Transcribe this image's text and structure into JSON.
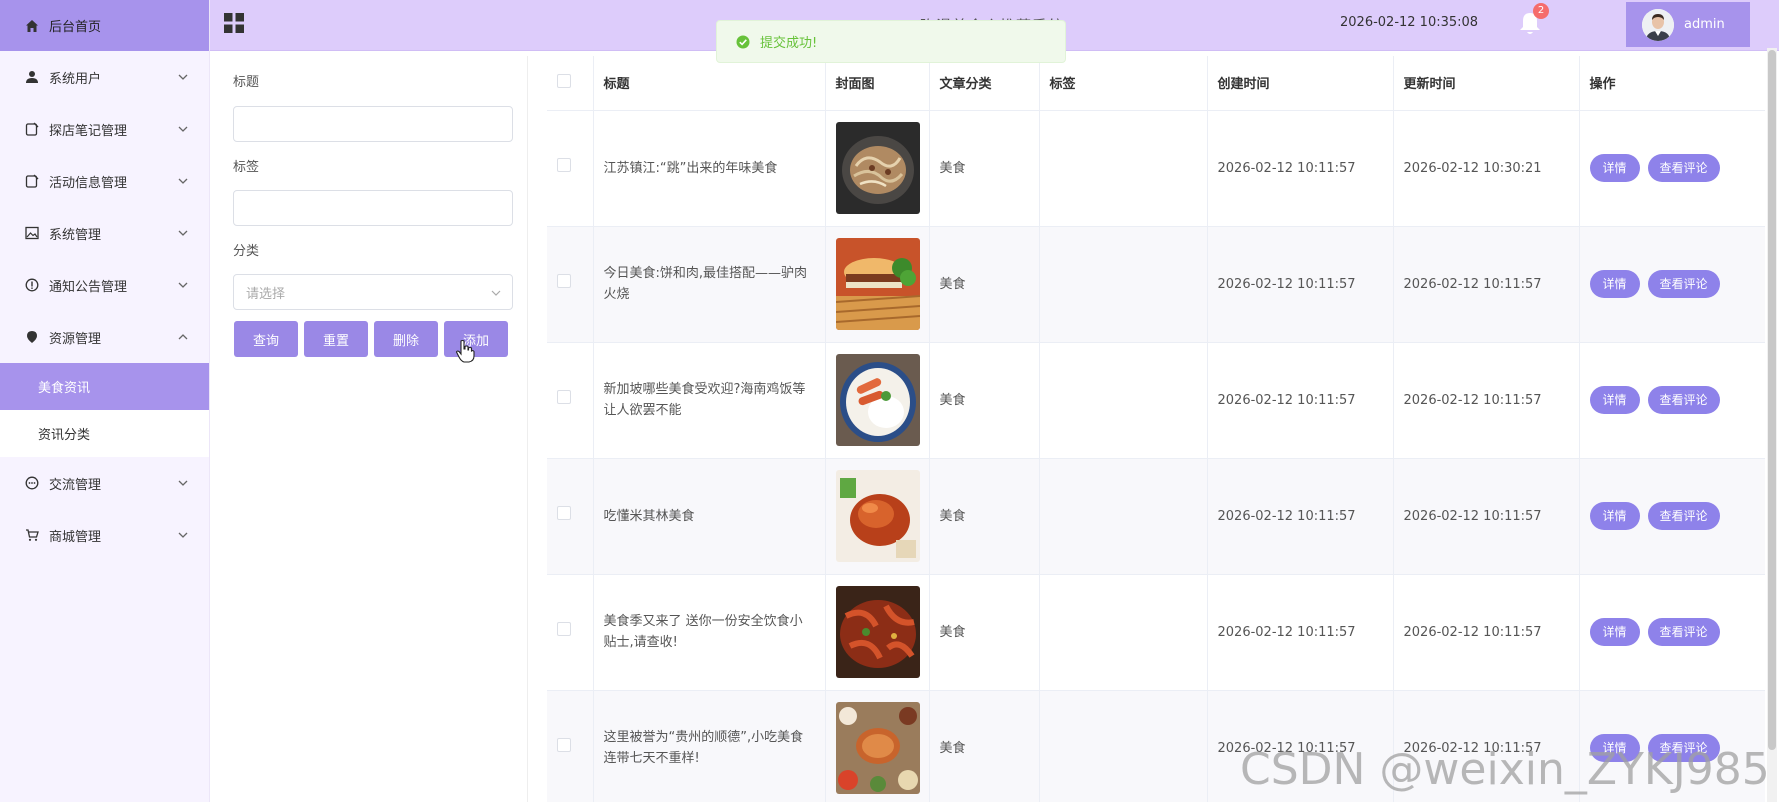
{
  "sidebar": {
    "home": "后台首页",
    "items": [
      {
        "label": "系统用户",
        "icon": "user-icon",
        "expanded": false
      },
      {
        "label": "探店笔记管理",
        "icon": "note-icon",
        "expanded": false
      },
      {
        "label": "活动信息管理",
        "icon": "note-icon",
        "expanded": false
      },
      {
        "label": "系统管理",
        "icon": "image-icon",
        "expanded": false
      },
      {
        "label": "通知公告管理",
        "icon": "info-icon",
        "expanded": false
      },
      {
        "label": "资源管理",
        "icon": "pin-icon",
        "expanded": true
      },
      {
        "label": "交流管理",
        "icon": "chat-icon",
        "expanded": false
      },
      {
        "label": "商城管理",
        "icon": "cart-icon",
        "expanded": false
      }
    ],
    "subitems": [
      {
        "label": "美食资讯",
        "active": true
      },
      {
        "label": "资讯分类",
        "active": false
      }
    ]
  },
  "header": {
    "system_title": "弥漫美食介推荐系统",
    "datetime": "2026-02-12 10:35:08",
    "notification_count": "2",
    "username": "admin"
  },
  "toast": {
    "message": "提交成功!"
  },
  "search": {
    "title_label": "标题",
    "title_value": "",
    "tag_label": "标签",
    "tag_value": "",
    "category_label": "分类",
    "category_placeholder": "请选择",
    "buttons": {
      "query": "查询",
      "reset": "重置",
      "delete": "删除",
      "add": "添加"
    }
  },
  "table": {
    "columns": [
      "标题",
      "封面图",
      "文章分类",
      "标签",
      "创建时间",
      "更新时间",
      "操作"
    ],
    "rows": [
      {
        "title": "江苏镇江:“跳”出来的年味美食",
        "category": "美食",
        "tag": "",
        "created": "2026-02-12 10:11:57",
        "updated": "2026-02-12 10:30:21"
      },
      {
        "title": "今日美食:饼和肉,最佳搭配——驴肉火烧",
        "category": "美食",
        "tag": "",
        "created": "2026-02-12 10:11:57",
        "updated": "2026-02-12 10:11:57"
      },
      {
        "title": "新加坡哪些美食受欢迎?海南鸡饭等让人欲罢不能",
        "category": "美食",
        "tag": "",
        "created": "2026-02-12 10:11:57",
        "updated": "2026-02-12 10:11:57"
      },
      {
        "title": "吃懂米其林美食",
        "category": "美食",
        "tag": "",
        "created": "2026-02-12 10:11:57",
        "updated": "2026-02-12 10:11:57"
      },
      {
        "title": "美食季又来了 送你一份安全饮食小贴士,请查收!",
        "category": "美食",
        "tag": "",
        "created": "2026-02-12 10:11:57",
        "updated": "2026-02-12 10:11:57"
      },
      {
        "title": "这里被誉为“贵州的顺德”,小吃美食连带七天不重样!",
        "category": "美食",
        "tag": "",
        "created": "2026-02-12 10:11:57",
        "updated": "2026-02-12 10:11:57"
      }
    ],
    "actions": {
      "detail": "详情",
      "comments": "查看评论"
    }
  },
  "watermark": "CSDN @weixin_ZYKJ985",
  "colors": {
    "accent": "#a793ec",
    "header_bg": "#ddccfb",
    "button": "#9a88e6",
    "success": "#67c23a"
  }
}
